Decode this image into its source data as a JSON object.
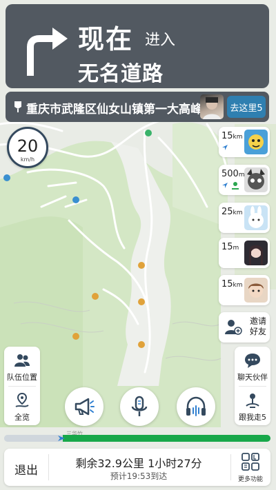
{
  "navigation": {
    "action": "现在",
    "action_suffix": "进入",
    "road": "无名道路"
  },
  "destination": {
    "name": "重庆市武隆区仙女山镇第一大高峰",
    "go_button": "去这里5"
  },
  "speed": {
    "value": "20",
    "unit": "km/h"
  },
  "team_members": [
    {
      "distance_num": "15",
      "distance_unit": "km",
      "icon": "navigate-arrow-icon"
    },
    {
      "distance_num": "500",
      "distance_unit": "m",
      "icon": "navigate-arrow-icon",
      "extra_icon": "team-follow-icon"
    },
    {
      "distance_num": "25",
      "distance_unit": "km",
      "icon": ""
    },
    {
      "distance_num": "15",
      "distance_unit": "m",
      "icon": ""
    },
    {
      "distance_num": "15",
      "distance_unit": "km",
      "icon": ""
    }
  ],
  "invite": {
    "label": "邀请好友"
  },
  "left_panel": {
    "team_position": "队伍位置",
    "overview": "全览"
  },
  "right_panel": {
    "chat": "聊天伙伴",
    "follow_me": "跟我走5"
  },
  "controls": [
    "megaphone-icon",
    "microphone-icon",
    "headphones-icon"
  ],
  "progress": {
    "completed_fraction": 0.22
  },
  "bottom_bar": {
    "exit": "退出",
    "remaining": "剩余32.9公里",
    "duration": "1小时27分",
    "eta": "预计19:53到达",
    "more": "更多功能"
  },
  "map_labels": [
    "三华竹"
  ],
  "colors": {
    "banner": "#464e56",
    "go_button": "#2f7fb0",
    "route_green": "#18a84a",
    "map_green": "#d4e7c5"
  }
}
